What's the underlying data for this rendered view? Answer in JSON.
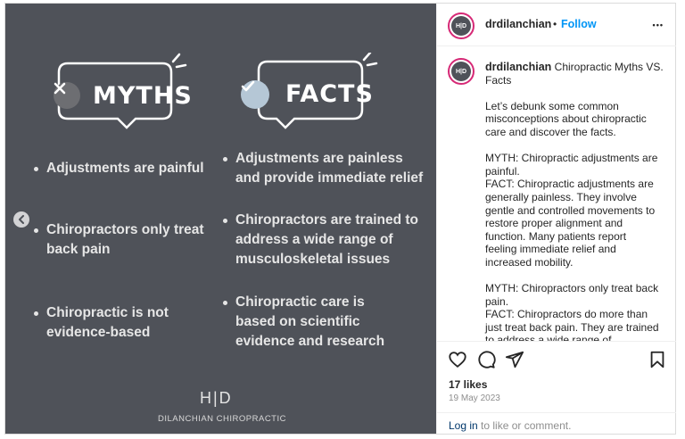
{
  "post_image": {
    "myths_title": "MYTHS",
    "facts_title": "FACTS",
    "myths": [
      [
        "Adjustments are painful"
      ],
      [
        "Chiropractors only treat",
        "back pain"
      ],
      [
        "Chiropractic is not",
        "evidence-based"
      ]
    ],
    "facts": [
      [
        "Adjustments are painless",
        "and provide immediate relief"
      ],
      [
        "Chiropractors are trained to",
        "address a wide range of",
        "musculoskeletal issues"
      ],
      [
        "Chiropractic care is",
        "based on scientific",
        "evidence and research"
      ]
    ],
    "brand_logo": "H|D",
    "brand_name": "DILANCHIAN CHIROPRACTIC",
    "colors": {
      "background": "#4f5259",
      "myth_badge": "#6d6e72",
      "fact_badge": "#b5c7d6"
    }
  },
  "header": {
    "username": "drdilanchian",
    "separator": "•",
    "follow_label": "Follow",
    "more_label": "•••",
    "avatar_text": "H|D"
  },
  "caption": {
    "username": "drdilanchian",
    "title": "Chiropractic Myths VS. Facts",
    "lines": [
      "Let’s debunk some common",
      "misconceptions about chiropractic",
      "care and discover the facts.",
      "",
      "MYTH: Chiropractic adjustments are",
      "painful.",
      "FACT: Chiropractic adjustments are",
      "generally painless. They involve",
      "gentle and controlled movements to",
      "restore proper alignment and",
      "function. Many patients report",
      "feeling immediate relief and",
      "increased mobility.",
      "",
      "MYTH: Chiropractors only treat back",
      "pain.",
      "FACT: Chiropractors do more than",
      "just treat back pain. They are trained",
      "to address a wide range of"
    ]
  },
  "actions": {
    "like_icon": "heart-icon",
    "comment_icon": "comment-icon",
    "share_icon": "paper-plane-icon",
    "save_icon": "bookmark-icon"
  },
  "stats": {
    "likes": "17 likes",
    "date": "19 May 2023"
  },
  "footer": {
    "login_link": "Log in",
    "login_rest": " to like or comment."
  }
}
